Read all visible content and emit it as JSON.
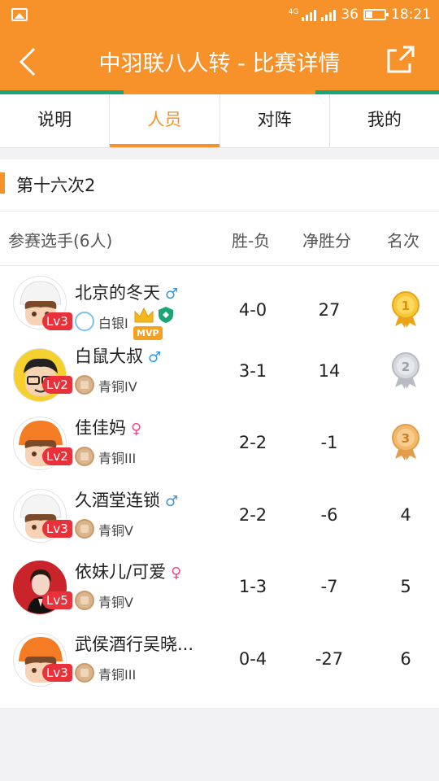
{
  "status_bar": {
    "network": "4G",
    "signal_text": "36",
    "time": "18:21"
  },
  "header": {
    "title": "中羽联八人转 - 比赛详情"
  },
  "tabs": [
    {
      "label": "说明",
      "active": false
    },
    {
      "label": "人员",
      "active": true
    },
    {
      "label": "对阵",
      "active": false
    },
    {
      "label": "我的",
      "active": false
    }
  ],
  "section": {
    "title": "第十六次2"
  },
  "table": {
    "headers": {
      "player": "参赛选手(6人)",
      "record": "胜-负",
      "net": "净胜分",
      "rank": "名次"
    },
    "rows": [
      {
        "name": "北京的冬天",
        "gender": "♂",
        "level": "Lv3",
        "rank_title": "白银I",
        "record": "4-0",
        "net": "27",
        "place": "1",
        "mvp": "MVP"
      },
      {
        "name": "白鼠大叔",
        "gender": "♂",
        "level": "Lv2",
        "rank_title": "青铜IV",
        "record": "3-1",
        "net": "14",
        "place": "2"
      },
      {
        "name": "佳佳妈",
        "gender": "♀",
        "level": "Lv2",
        "rank_title": "青铜III",
        "record": "2-2",
        "net": "-1",
        "place": "3"
      },
      {
        "name": "久酒堂连锁",
        "gender": "♂",
        "level": "Lv3",
        "rank_title": "青铜V",
        "record": "2-2",
        "net": "-6",
        "place": "4"
      },
      {
        "name": "依妹儿/可爱",
        "gender": "♀",
        "level": "Lv5",
        "rank_title": "青铜V",
        "record": "1-3",
        "net": "-7",
        "place": "5"
      },
      {
        "name": "武侯酒行吴晓...",
        "gender": "",
        "level": "Lv3",
        "rank_title": "青铜III",
        "record": "0-4",
        "net": "-27",
        "place": "6"
      }
    ]
  },
  "colors": {
    "accent": "#f7922a",
    "green": "#1aa579",
    "level_red": "#e8313a",
    "gold": "#f2b31c"
  }
}
